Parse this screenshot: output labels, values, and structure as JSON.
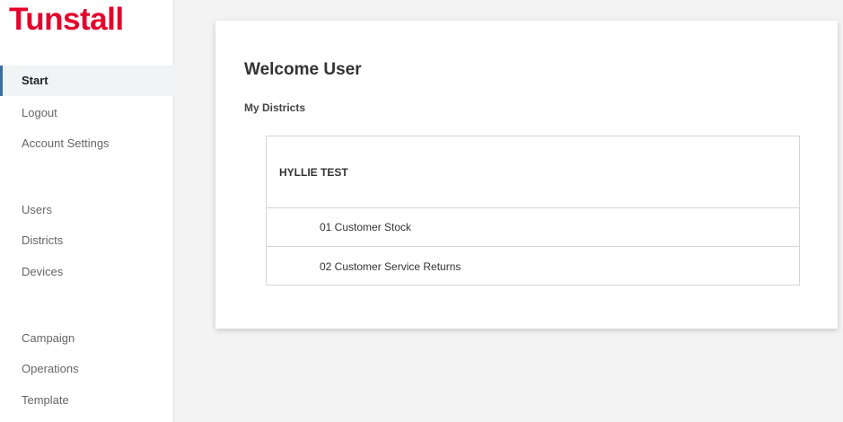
{
  "brand": {
    "logo_text": "Tunstall",
    "color": "#e4002b"
  },
  "sidebar": {
    "items": [
      {
        "label": "Start",
        "active": true
      },
      {
        "label": "Logout"
      },
      {
        "label": "Account Settings"
      },
      {
        "label": "Users"
      },
      {
        "label": "Districts"
      },
      {
        "label": "Devices"
      },
      {
        "label": "Campaign"
      },
      {
        "label": "Operations"
      },
      {
        "label": "Template"
      }
    ]
  },
  "main": {
    "title": "Welcome User",
    "section_label": "My Districts",
    "district": {
      "name": "HYLLIE TEST",
      "sub_items": [
        {
          "label": "01 Customer Stock"
        },
        {
          "label": "02 Customer Service Returns"
        }
      ]
    }
  }
}
